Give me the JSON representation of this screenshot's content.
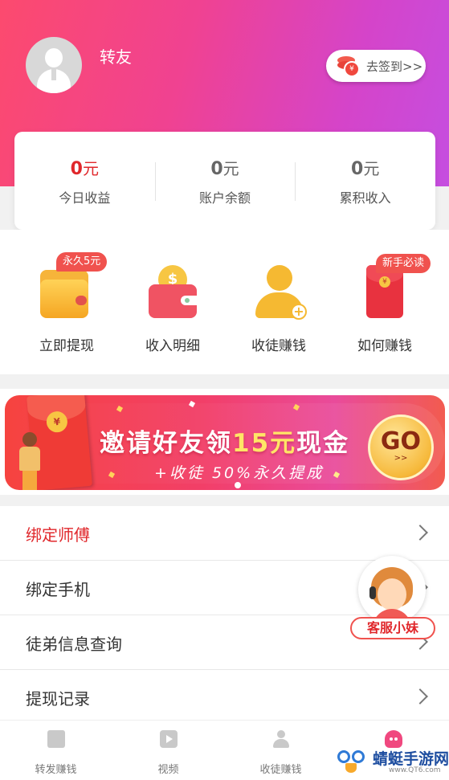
{
  "header": {
    "username": "转友",
    "checkin_label": "去签到>>"
  },
  "stats": [
    {
      "value": "0",
      "unit": "元",
      "label": "今日收益",
      "highlight": true
    },
    {
      "value": "0",
      "unit": "元",
      "label": "账户余额",
      "highlight": false
    },
    {
      "value": "0",
      "unit": "元",
      "label": "累积收入",
      "highlight": false
    }
  ],
  "actions": [
    {
      "label": "立即提现",
      "badge": "永久5元",
      "icon": "wallet-icon"
    },
    {
      "label": "收入明细",
      "badge": "",
      "icon": "income-wallet-icon"
    },
    {
      "label": "收徒赚钱",
      "badge": "",
      "icon": "add-disciple-icon"
    },
    {
      "label": "如何赚钱",
      "badge": "新手必读",
      "icon": "red-envelope-icon"
    }
  ],
  "banner": {
    "title_part1": "邀请好友领",
    "title_highlight": "15元",
    "title_part2": "现金",
    "subtitle": "+收徒 50%永久提成",
    "go_label": "GO",
    "go_arrow": ">>",
    "envelope_glyph": "¥"
  },
  "menu": [
    {
      "label": "绑定师傅",
      "highlight": true
    },
    {
      "label": "绑定手机",
      "highlight": false
    },
    {
      "label": "徒弟信息查询",
      "highlight": false
    },
    {
      "label": "提现记录",
      "highlight": false
    }
  ],
  "customer_service": {
    "label": "客服小妹"
  },
  "bottom_nav": [
    {
      "label": "转发赚钱",
      "icon": "article-icon",
      "active": false
    },
    {
      "label": "视频",
      "icon": "video-icon",
      "active": false
    },
    {
      "label": "收徒赚钱",
      "icon": "user-icon",
      "active": false
    },
    {
      "label": "",
      "icon": "me-icon",
      "active": true
    }
  ],
  "watermark": {
    "text": "蜻蜓手游网",
    "url": "www.QT6.com"
  },
  "colors": {
    "header_gradient_start": "#fc4a6e",
    "header_gradient_end": "#c54ee0",
    "accent_red": "#e0272b",
    "icon_gold": "#f5b932"
  }
}
